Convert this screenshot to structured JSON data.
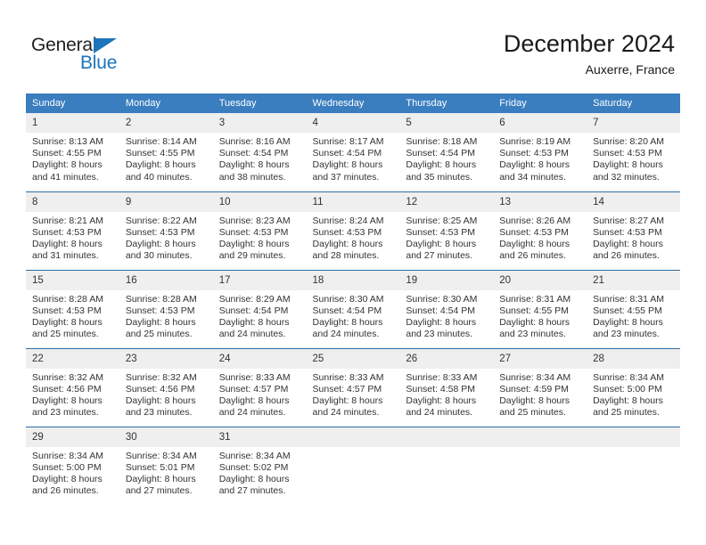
{
  "brand": {
    "name_part1": "General",
    "name_part2": "Blue"
  },
  "header": {
    "title": "December 2024",
    "subtitle": "Auxerre, France"
  },
  "colors": {
    "header_blue": "#3a7ebf",
    "row_separator": "#2e6da4",
    "daynum_band": "#efefef",
    "brand_blue": "#1b75bb",
    "text": "#333333"
  },
  "weekdays": [
    "Sunday",
    "Monday",
    "Tuesday",
    "Wednesday",
    "Thursday",
    "Friday",
    "Saturday"
  ],
  "weeks": [
    [
      {
        "day": "1",
        "sunrise": "Sunrise: 8:13 AM",
        "sunset": "Sunset: 4:55 PM",
        "daylight1": "Daylight: 8 hours",
        "daylight2": "and 41 minutes."
      },
      {
        "day": "2",
        "sunrise": "Sunrise: 8:14 AM",
        "sunset": "Sunset: 4:55 PM",
        "daylight1": "Daylight: 8 hours",
        "daylight2": "and 40 minutes."
      },
      {
        "day": "3",
        "sunrise": "Sunrise: 8:16 AM",
        "sunset": "Sunset: 4:54 PM",
        "daylight1": "Daylight: 8 hours",
        "daylight2": "and 38 minutes."
      },
      {
        "day": "4",
        "sunrise": "Sunrise: 8:17 AM",
        "sunset": "Sunset: 4:54 PM",
        "daylight1": "Daylight: 8 hours",
        "daylight2": "and 37 minutes."
      },
      {
        "day": "5",
        "sunrise": "Sunrise: 8:18 AM",
        "sunset": "Sunset: 4:54 PM",
        "daylight1": "Daylight: 8 hours",
        "daylight2": "and 35 minutes."
      },
      {
        "day": "6",
        "sunrise": "Sunrise: 8:19 AM",
        "sunset": "Sunset: 4:53 PM",
        "daylight1": "Daylight: 8 hours",
        "daylight2": "and 34 minutes."
      },
      {
        "day": "7",
        "sunrise": "Sunrise: 8:20 AM",
        "sunset": "Sunset: 4:53 PM",
        "daylight1": "Daylight: 8 hours",
        "daylight2": "and 32 minutes."
      }
    ],
    [
      {
        "day": "8",
        "sunrise": "Sunrise: 8:21 AM",
        "sunset": "Sunset: 4:53 PM",
        "daylight1": "Daylight: 8 hours",
        "daylight2": "and 31 minutes."
      },
      {
        "day": "9",
        "sunrise": "Sunrise: 8:22 AM",
        "sunset": "Sunset: 4:53 PM",
        "daylight1": "Daylight: 8 hours",
        "daylight2": "and 30 minutes."
      },
      {
        "day": "10",
        "sunrise": "Sunrise: 8:23 AM",
        "sunset": "Sunset: 4:53 PM",
        "daylight1": "Daylight: 8 hours",
        "daylight2": "and 29 minutes."
      },
      {
        "day": "11",
        "sunrise": "Sunrise: 8:24 AM",
        "sunset": "Sunset: 4:53 PM",
        "daylight1": "Daylight: 8 hours",
        "daylight2": "and 28 minutes."
      },
      {
        "day": "12",
        "sunrise": "Sunrise: 8:25 AM",
        "sunset": "Sunset: 4:53 PM",
        "daylight1": "Daylight: 8 hours",
        "daylight2": "and 27 minutes."
      },
      {
        "day": "13",
        "sunrise": "Sunrise: 8:26 AM",
        "sunset": "Sunset: 4:53 PM",
        "daylight1": "Daylight: 8 hours",
        "daylight2": "and 26 minutes."
      },
      {
        "day": "14",
        "sunrise": "Sunrise: 8:27 AM",
        "sunset": "Sunset: 4:53 PM",
        "daylight1": "Daylight: 8 hours",
        "daylight2": "and 26 minutes."
      }
    ],
    [
      {
        "day": "15",
        "sunrise": "Sunrise: 8:28 AM",
        "sunset": "Sunset: 4:53 PM",
        "daylight1": "Daylight: 8 hours",
        "daylight2": "and 25 minutes."
      },
      {
        "day": "16",
        "sunrise": "Sunrise: 8:28 AM",
        "sunset": "Sunset: 4:53 PM",
        "daylight1": "Daylight: 8 hours",
        "daylight2": "and 25 minutes."
      },
      {
        "day": "17",
        "sunrise": "Sunrise: 8:29 AM",
        "sunset": "Sunset: 4:54 PM",
        "daylight1": "Daylight: 8 hours",
        "daylight2": "and 24 minutes."
      },
      {
        "day": "18",
        "sunrise": "Sunrise: 8:30 AM",
        "sunset": "Sunset: 4:54 PM",
        "daylight1": "Daylight: 8 hours",
        "daylight2": "and 24 minutes."
      },
      {
        "day": "19",
        "sunrise": "Sunrise: 8:30 AM",
        "sunset": "Sunset: 4:54 PM",
        "daylight1": "Daylight: 8 hours",
        "daylight2": "and 23 minutes."
      },
      {
        "day": "20",
        "sunrise": "Sunrise: 8:31 AM",
        "sunset": "Sunset: 4:55 PM",
        "daylight1": "Daylight: 8 hours",
        "daylight2": "and 23 minutes."
      },
      {
        "day": "21",
        "sunrise": "Sunrise: 8:31 AM",
        "sunset": "Sunset: 4:55 PM",
        "daylight1": "Daylight: 8 hours",
        "daylight2": "and 23 minutes."
      }
    ],
    [
      {
        "day": "22",
        "sunrise": "Sunrise: 8:32 AM",
        "sunset": "Sunset: 4:56 PM",
        "daylight1": "Daylight: 8 hours",
        "daylight2": "and 23 minutes."
      },
      {
        "day": "23",
        "sunrise": "Sunrise: 8:32 AM",
        "sunset": "Sunset: 4:56 PM",
        "daylight1": "Daylight: 8 hours",
        "daylight2": "and 23 minutes."
      },
      {
        "day": "24",
        "sunrise": "Sunrise: 8:33 AM",
        "sunset": "Sunset: 4:57 PM",
        "daylight1": "Daylight: 8 hours",
        "daylight2": "and 24 minutes."
      },
      {
        "day": "25",
        "sunrise": "Sunrise: 8:33 AM",
        "sunset": "Sunset: 4:57 PM",
        "daylight1": "Daylight: 8 hours",
        "daylight2": "and 24 minutes."
      },
      {
        "day": "26",
        "sunrise": "Sunrise: 8:33 AM",
        "sunset": "Sunset: 4:58 PM",
        "daylight1": "Daylight: 8 hours",
        "daylight2": "and 24 minutes."
      },
      {
        "day": "27",
        "sunrise": "Sunrise: 8:34 AM",
        "sunset": "Sunset: 4:59 PM",
        "daylight1": "Daylight: 8 hours",
        "daylight2": "and 25 minutes."
      },
      {
        "day": "28",
        "sunrise": "Sunrise: 8:34 AM",
        "sunset": "Sunset: 5:00 PM",
        "daylight1": "Daylight: 8 hours",
        "daylight2": "and 25 minutes."
      }
    ],
    [
      {
        "day": "29",
        "sunrise": "Sunrise: 8:34 AM",
        "sunset": "Sunset: 5:00 PM",
        "daylight1": "Daylight: 8 hours",
        "daylight2": "and 26 minutes."
      },
      {
        "day": "30",
        "sunrise": "Sunrise: 8:34 AM",
        "sunset": "Sunset: 5:01 PM",
        "daylight1": "Daylight: 8 hours",
        "daylight2": "and 27 minutes."
      },
      {
        "day": "31",
        "sunrise": "Sunrise: 8:34 AM",
        "sunset": "Sunset: 5:02 PM",
        "daylight1": "Daylight: 8 hours",
        "daylight2": "and 27 minutes."
      },
      {
        "day": "",
        "sunrise": "",
        "sunset": "",
        "daylight1": "",
        "daylight2": ""
      },
      {
        "day": "",
        "sunrise": "",
        "sunset": "",
        "daylight1": "",
        "daylight2": ""
      },
      {
        "day": "",
        "sunrise": "",
        "sunset": "",
        "daylight1": "",
        "daylight2": ""
      },
      {
        "day": "",
        "sunrise": "",
        "sunset": "",
        "daylight1": "",
        "daylight2": ""
      }
    ]
  ]
}
